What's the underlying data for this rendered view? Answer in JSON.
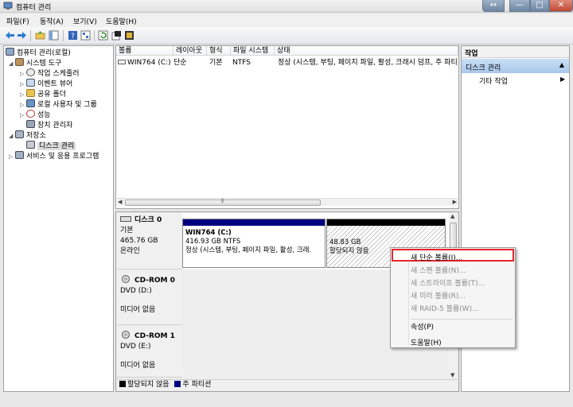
{
  "window": {
    "title": "컴퓨터 관리"
  },
  "window_buttons": {
    "size": "↔",
    "minimize": "—",
    "maximize": "□",
    "close": "✕"
  },
  "menu": [
    "파일(F)",
    "동작(A)",
    "보기(V)",
    "도움말(H)"
  ],
  "toolbar": [
    "back-arrow-icon",
    "forward-arrow-icon",
    "up-folder-icon",
    "show-hide-tree-icon",
    "help-icon",
    "properties-icon",
    "refresh-icon",
    "export-icon",
    "settings-icon"
  ],
  "tree": {
    "root": "컴퓨터 관리(로컬)",
    "system_tools": "시스템 도구",
    "task_scheduler": "작업 스케줄러",
    "event_viewer": "이벤트 뷰어",
    "shared_folders": "공유 폴더",
    "local_users": "로컬 사용자 및 그룹",
    "performance": "성능",
    "device_manager": "장치 관리자",
    "storage": "저장소",
    "disk_management": "디스크 관리",
    "services": "서비스 및 응용 프로그램"
  },
  "volume_list": {
    "headers": [
      "볼륨",
      "레이아웃",
      "형식",
      "파일 시스템",
      "상태"
    ],
    "rows": [
      {
        "volume": "WIN764 (C:)",
        "layout": "단순",
        "type": "기본",
        "fs": "NTFS",
        "status": "정상 (시스템, 부팅, 페이지 파일, 활성, 크래시 덤프, 주 파티"
      }
    ],
    "scroll_grip": "⦀"
  },
  "disks": {
    "disk0": {
      "name": "디스크 0",
      "type": "기본",
      "size": "465.76 GB",
      "state": "온라인"
    },
    "partition_c": {
      "name": "WIN764  (C:)",
      "size": "416.93 GB NTFS",
      "status": "정상 (시스템, 부팅, 페이지 파일, 활성, 크래."
    },
    "unallocated": {
      "size": "48.83 GB",
      "status": "할당되지 않음"
    },
    "cdrom0": {
      "name": "CD-ROM 0",
      "drive": "DVD (D:)",
      "media": "미디어 없음"
    },
    "cdrom1": {
      "name": "CD-ROM 1",
      "drive": "DVD (E:)",
      "media": "미디어 없음"
    }
  },
  "legend": {
    "unallocated": "할당되지 않음",
    "primary": "주 파티션"
  },
  "actions": {
    "header": "작업",
    "section": "디스크 관리",
    "more": "기타 작업"
  },
  "context_menu": {
    "new_simple": "새 단순 볼륨(I)...",
    "new_spanned": "새 스팬 볼륨(N)...",
    "new_striped": "새 스트라이프 볼륨(T)...",
    "new_mirrored": "새 미러 볼륨(R)...",
    "new_raid5": "새 RAID-5 볼륨(W)...",
    "properties": "속성(P)",
    "help": "도움말(H)"
  },
  "colors": {
    "primary_partition": "#000080",
    "unallocated": "#000000",
    "highlight": "#e8242b",
    "action_header": "#b4cfee"
  }
}
